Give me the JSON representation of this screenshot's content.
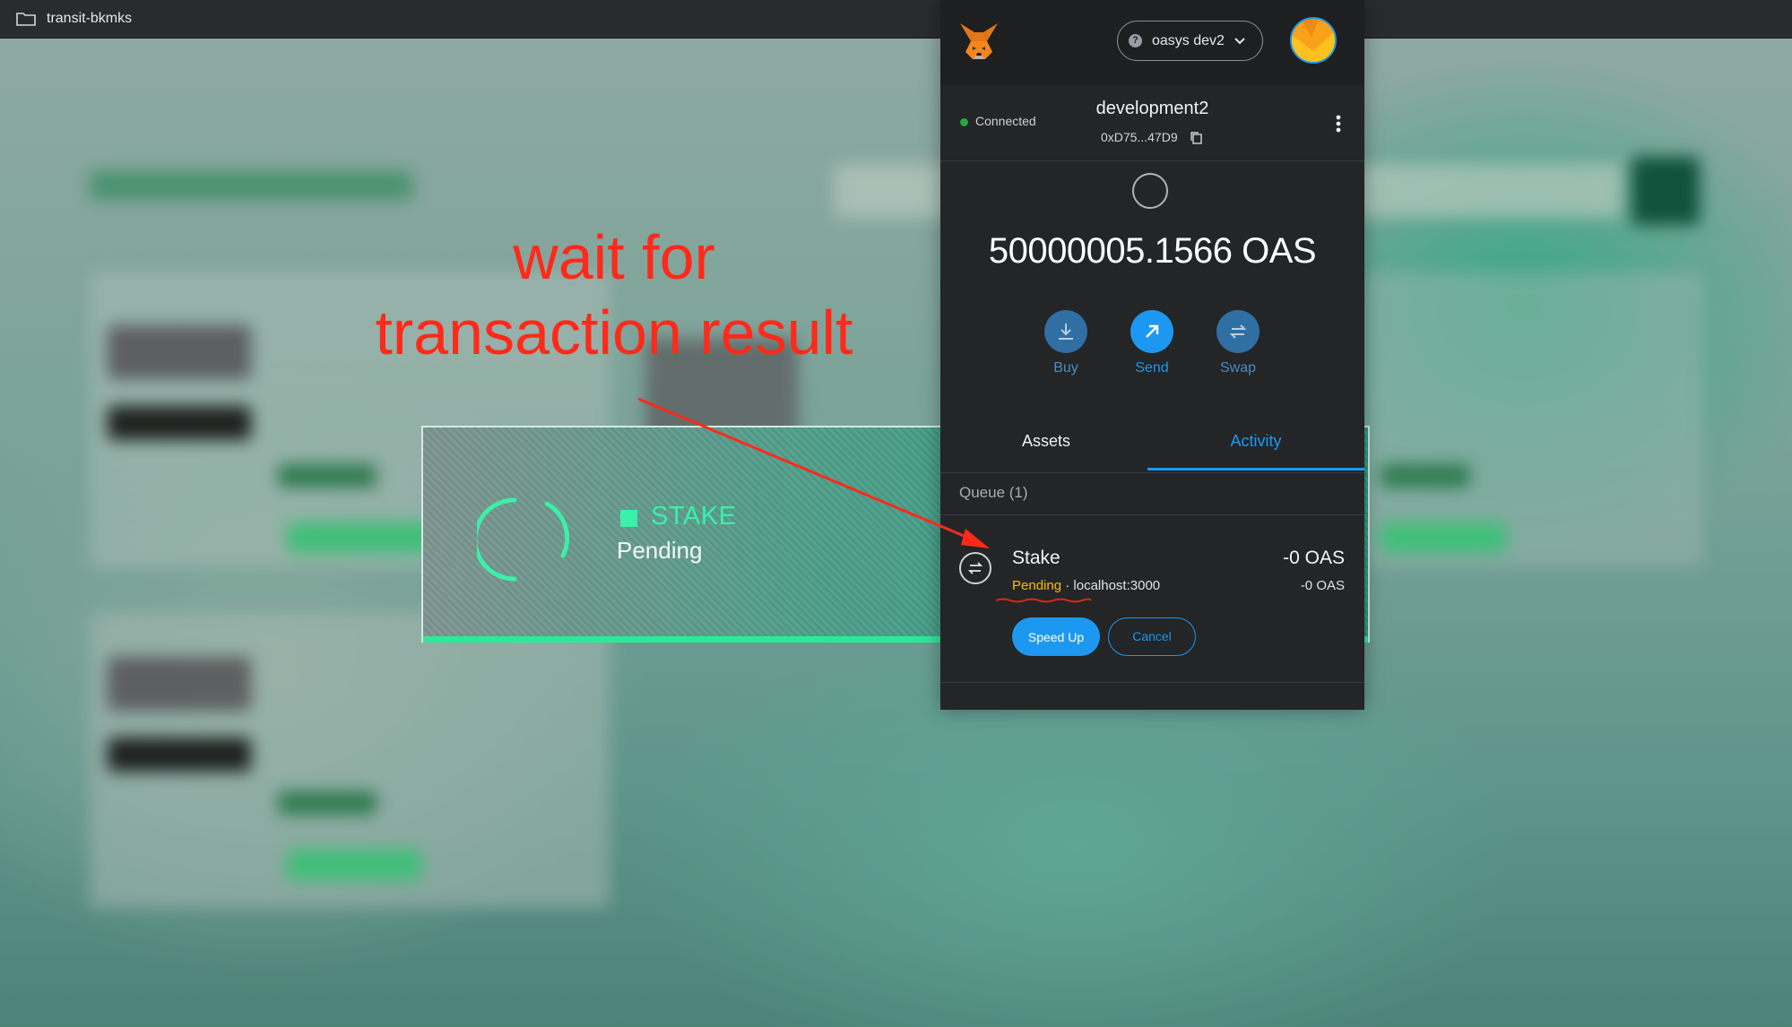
{
  "window": {
    "title": "transit-bkmks"
  },
  "annotation": {
    "line1": "wait for",
    "line2": "transaction result"
  },
  "toast": {
    "type": "STAKE",
    "status": "Pending"
  },
  "wallet": {
    "network": "oasys dev2",
    "connection_status": "Connected",
    "account_name": "development2",
    "account_address": "0xD75...47D9",
    "balance": "50000005.1566 OAS",
    "actions": {
      "buy": "Buy",
      "send": "Send",
      "swap": "Swap"
    },
    "tabs": {
      "assets": "Assets",
      "activity": "Activity"
    },
    "queue_label": "Queue (1)",
    "transaction": {
      "title": "Stake",
      "status": "Pending",
      "origin": " · localhost:3000",
      "amount": "-0 OAS",
      "amount_secondary": "-0 OAS",
      "speed_up_label": "Speed Up",
      "cancel_label": "Cancel"
    }
  },
  "colors": {
    "accent": "#1d98f0",
    "pending": "#f8c000",
    "annotation": "#ff2a1a",
    "toast_green": "#3bf0a8",
    "connected": "#28a745"
  }
}
